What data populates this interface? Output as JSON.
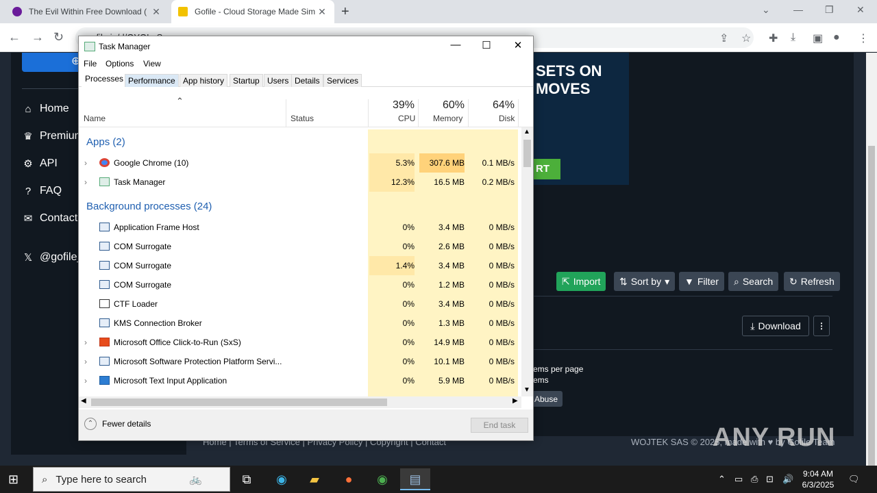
{
  "browser": {
    "tabs": [
      {
        "title": "The Evil Within Free Download (",
        "favicon_color": "#6a1b9a"
      },
      {
        "title": "Gofile - Cloud Storage Made Sim",
        "favicon_color": "#f2c200"
      }
    ],
    "url": "gofile.io/d/GYQLqS"
  },
  "site": {
    "sidebar": [
      {
        "label": "Home",
        "icon": "home-icon"
      },
      {
        "label": "Premium",
        "icon": "crown-icon"
      },
      {
        "label": "API",
        "icon": "cogs-icon"
      },
      {
        "label": "FAQ",
        "icon": "question-icon"
      },
      {
        "label": "Contact",
        "icon": "envelope-icon"
      },
      {
        "label": "@gofile_",
        "icon": "x-icon"
      }
    ],
    "ad": {
      "line1": "SETS ON",
      "line2": "MOVES",
      "button": "RT"
    },
    "actions": {
      "import": "Import",
      "sort": "Sort by",
      "filter": "Filter",
      "search": "Search",
      "refresh": "Refresh"
    },
    "download": "Download",
    "items_per_page": "ems per page",
    "items": "ems",
    "abuse": "Abuse",
    "footer": {
      "links": "Home | Terms of Service | Privacy Policy | Copyright | Contact",
      "copyright": "WOJTEK SAS © 2025, made with ♥ by Gofile Team"
    }
  },
  "watermark": "ANY RUN",
  "task_manager": {
    "title": "Task Manager",
    "menu": [
      "File",
      "Options",
      "View"
    ],
    "tabs": [
      "Processes",
      "Performance",
      "App history",
      "Startup",
      "Users",
      "Details",
      "Services"
    ],
    "columns": {
      "name": "Name",
      "status": "Status",
      "cpu_pct": "39%",
      "cpu": "CPU",
      "mem_pct": "60%",
      "mem": "Memory",
      "disk_pct": "64%",
      "disk": "Disk"
    },
    "apps_group": "Apps (2)",
    "apps": [
      {
        "name": "Google Chrome (10)",
        "cpu": "5.3%",
        "mem": "307.6 MB",
        "disk": "0.1 MB/s"
      },
      {
        "name": "Task Manager",
        "cpu": "12.3%",
        "mem": "16.5 MB",
        "disk": "0.2 MB/s"
      }
    ],
    "bg_group": "Background processes (24)",
    "background": [
      {
        "name": "Application Frame Host",
        "cpu": "0%",
        "mem": "3.4 MB",
        "disk": "0 MB/s"
      },
      {
        "name": "COM Surrogate",
        "cpu": "0%",
        "mem": "2.6 MB",
        "disk": "0 MB/s"
      },
      {
        "name": "COM Surrogate",
        "cpu": "1.4%",
        "mem": "3.4 MB",
        "disk": "0 MB/s"
      },
      {
        "name": "COM Surrogate",
        "cpu": "0%",
        "mem": "1.2 MB",
        "disk": "0 MB/s"
      },
      {
        "name": "CTF Loader",
        "cpu": "0%",
        "mem": "3.4 MB",
        "disk": "0 MB/s"
      },
      {
        "name": "KMS Connection Broker",
        "cpu": "0%",
        "mem": "1.3 MB",
        "disk": "0 MB/s"
      },
      {
        "name": "Microsoft Office Click-to-Run (SxS)",
        "cpu": "0%",
        "mem": "14.9 MB",
        "disk": "0 MB/s"
      },
      {
        "name": "Microsoft Software Protection Platform Servi...",
        "cpu": "0%",
        "mem": "10.1 MB",
        "disk": "0 MB/s"
      },
      {
        "name": "Microsoft Text Input Application",
        "cpu": "0%",
        "mem": "5.9 MB",
        "disk": "0 MB/s"
      }
    ],
    "fewer_details": "Fewer details",
    "end_task": "End task"
  },
  "taskbar": {
    "search_placeholder": "Type here to search",
    "time": "9:04 AM",
    "date": "6/3/2025"
  }
}
